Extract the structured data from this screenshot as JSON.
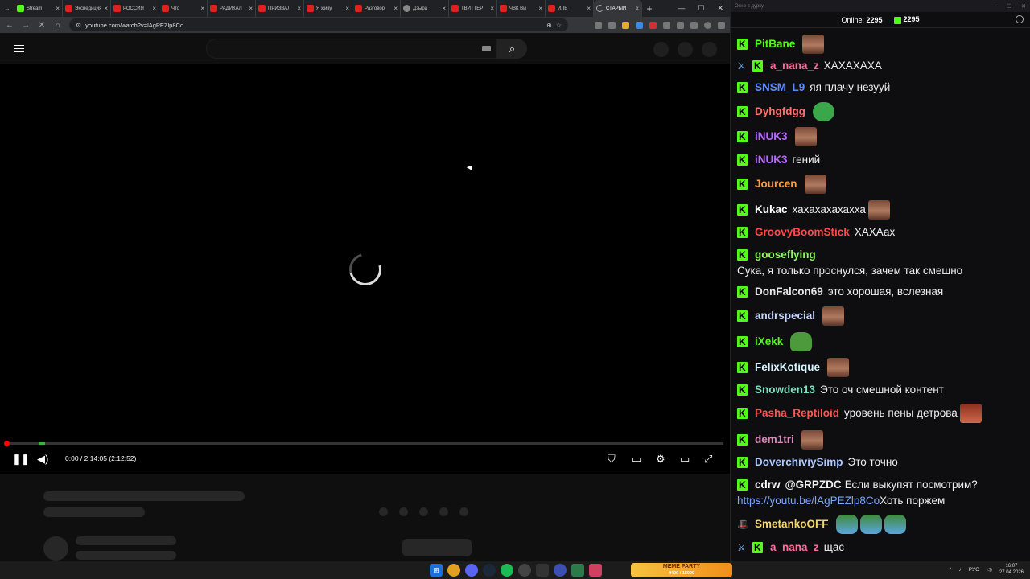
{
  "browser": {
    "tabs": [
      {
        "title": "Stream",
        "icon": "kick-icon",
        "active": false
      },
      {
        "title": "Экспедиция",
        "icon": "youtube-icon",
        "active": false
      },
      {
        "title": "РОССИЯ",
        "icon": "youtube-icon",
        "active": false
      },
      {
        "title": "Что",
        "icon": "youtube-icon",
        "active": false
      },
      {
        "title": "РАДИКАЛ",
        "icon": "youtube-icon",
        "active": false
      },
      {
        "title": "ПРИЗВАЛ",
        "icon": "youtube-icon",
        "active": false
      },
      {
        "title": "Я живу",
        "icon": "youtube-icon",
        "active": false
      },
      {
        "title": "Разговор",
        "icon": "youtube-icon",
        "active": false
      },
      {
        "title": "Дзыра",
        "icon": "dzen-icon",
        "active": false
      },
      {
        "title": "ТВИТТЕР",
        "icon": "youtube-icon",
        "active": false
      },
      {
        "title": "ЧВК Вы",
        "icon": "youtube-icon",
        "active": false
      },
      {
        "title": "ИЛЬ",
        "icon": "youtube-icon",
        "active": false
      },
      {
        "title": "СТАРЫЙ",
        "icon": "loading-icon",
        "active": true
      }
    ],
    "url": "youtube.com/watch?v=lAgPEZlp8Co"
  },
  "player": {
    "time": "0:00 / 2:14:05 (2:12:52)",
    "progress_fraction": 0
  },
  "chat": {
    "window_title": "Окно в дурку",
    "online_label": "Online:",
    "online_count": "2295",
    "kick_count": "2295",
    "messages": [
      {
        "user": "PitBane",
        "color": "#53fc18",
        "text": "",
        "emotes": [
          "face"
        ],
        "badges": [
          "kick"
        ]
      },
      {
        "user": "a_nana_z",
        "color": "#ff6b9a",
        "text": "ХАХАХАХА",
        "emotes": [],
        "badges": [
          "sword",
          "kick"
        ]
      },
      {
        "user": "SNSM_L9",
        "color": "#5b8cff",
        "text": "яя плачу незууй",
        "emotes": [],
        "badges": [
          "kick"
        ]
      },
      {
        "user": "Dyhgfdgg",
        "color": "#ff7070",
        "text": "",
        "emotes": [
          "toad"
        ],
        "badges": [
          "kick"
        ]
      },
      {
        "user": "iNUK3",
        "color": "#b86bff",
        "text": "",
        "emotes": [
          "face"
        ],
        "badges": [
          "kick"
        ]
      },
      {
        "user": "iNUK3",
        "color": "#b86bff",
        "text": "гений",
        "emotes": [],
        "badges": [
          "kick"
        ]
      },
      {
        "user": "Jourcen",
        "color": "#ff9a3d",
        "text": "",
        "emotes": [
          "face"
        ],
        "badges": [
          "kick"
        ]
      },
      {
        "user": "Kukac",
        "color": "#ffffff",
        "text": "хахахахахахха",
        "emotes": [
          "face"
        ],
        "badges": [
          "kick"
        ]
      },
      {
        "user": "GroovyBoomStick",
        "color": "#ff4a4a",
        "text": "ХАХАах",
        "emotes": [],
        "badges": [
          "kick"
        ]
      },
      {
        "user": "gooseflying",
        "color": "#8ef55a",
        "text": "Сука, я только проснулся, зачем так смешно",
        "emotes": [],
        "badges": [
          "kick"
        ]
      },
      {
        "user": "DonFalcon69",
        "color": "#e6e6e6",
        "text": "это хорошая, вслезная",
        "emotes": [],
        "badges": [
          "kick"
        ]
      },
      {
        "user": "andrspecial",
        "color": "#c8d7ff",
        "text": "",
        "emotes": [
          "face"
        ],
        "badges": [
          "kick"
        ]
      },
      {
        "user": "iXekk",
        "color": "#53fc18",
        "text": "",
        "emotes": [
          "pepe"
        ],
        "badges": [
          "kick"
        ]
      },
      {
        "user": "FelixKotique",
        "color": "#d9f5ff",
        "text": "",
        "emotes": [
          "face"
        ],
        "badges": [
          "kick"
        ]
      },
      {
        "user": "Snowden13",
        "color": "#7ee0c0",
        "text": "Это оч смешной контент",
        "emotes": [],
        "badges": [
          "kick"
        ]
      },
      {
        "user": "Pasha_Reptiloid",
        "color": "#ff5555",
        "text": "уровень пены детрова",
        "emotes": [
          "red"
        ],
        "badges": [
          "kick"
        ]
      },
      {
        "user": "dem1tri",
        "color": "#d98ab8",
        "text": "",
        "emotes": [
          "face"
        ],
        "badges": [
          "kick"
        ]
      },
      {
        "user": "DoverchiviySimp",
        "color": "#aec8ff",
        "text": "Это точно",
        "emotes": [],
        "badges": [
          "kick"
        ]
      },
      {
        "user": "cdrw",
        "color": "#ffffff",
        "mention": "@GRPZDC",
        "text": "Если выкупят посмотрим?",
        "link": "https://youtu.be/lAgPEZlp8Co",
        "after_link": "Хоть поржем",
        "emotes": [],
        "badges": [
          "kick"
        ]
      },
      {
        "user": "SmetankoOFF",
        "color": "#f5d76e",
        "text": "",
        "emotes": [
          "pepe2",
          "pepe2",
          "pepe2"
        ],
        "badges": [
          "hat"
        ]
      },
      {
        "user": "a_nana_z",
        "color": "#ff6b9a",
        "text": "щас",
        "emotes": [],
        "badges": [
          "sword",
          "kick"
        ]
      }
    ]
  },
  "taskbar": {
    "promo_title": "MEME PARTY",
    "promo_sub": "9400 / 15000",
    "lang": "РУС",
    "time": "16:07",
    "date": "27.04.2026"
  }
}
